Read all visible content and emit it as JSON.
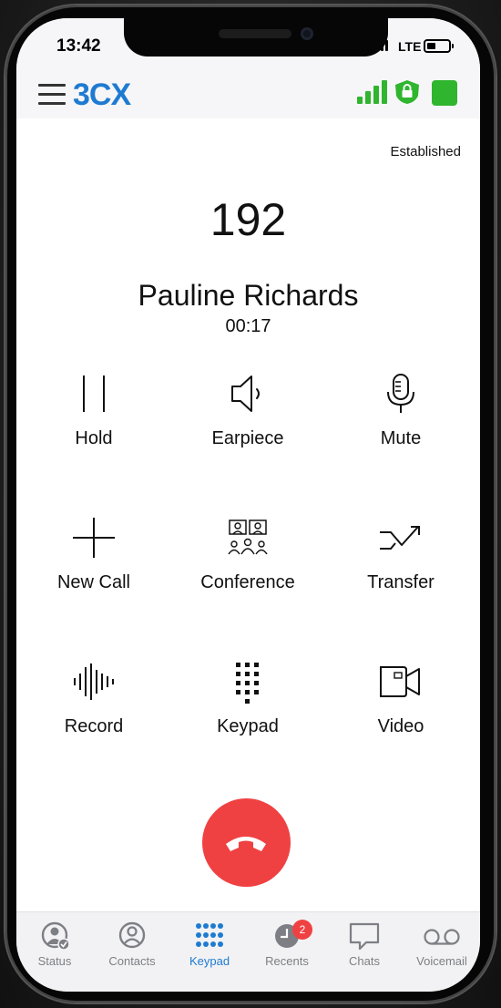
{
  "statusbar": {
    "time": "13:42",
    "network": "LTE",
    "battery_level": 0.4
  },
  "header": {
    "logo": "3CX",
    "signal_color": "#2fb52e",
    "presence_color": "#2fb52e"
  },
  "call": {
    "state": "Established",
    "number": "192",
    "name": "Pauline Richards",
    "duration": "00:17"
  },
  "actions": [
    {
      "label": "Hold",
      "icon": "pause-icon"
    },
    {
      "label": "Earpiece",
      "icon": "speaker-icon"
    },
    {
      "label": "Mute",
      "icon": "microphone-icon"
    },
    {
      "label": "New Call",
      "icon": "plus-icon"
    },
    {
      "label": "Conference",
      "icon": "conference-icon"
    },
    {
      "label": "Transfer",
      "icon": "transfer-icon"
    },
    {
      "label": "Record",
      "icon": "waveform-icon"
    },
    {
      "label": "Keypad",
      "icon": "dialpad-icon"
    },
    {
      "label": "Video",
      "icon": "video-camera-icon"
    }
  ],
  "hangup": {
    "icon": "hangup-phone-icon",
    "color": "#f04142"
  },
  "tabs": [
    {
      "label": "Status",
      "icon": "status-icon",
      "active": false
    },
    {
      "label": "Contacts",
      "icon": "contacts-icon",
      "active": false
    },
    {
      "label": "Keypad",
      "icon": "dialpad-icon",
      "active": true
    },
    {
      "label": "Recents",
      "icon": "clock-icon",
      "active": false,
      "badge": "2"
    },
    {
      "label": "Chats",
      "icon": "chat-bubble-icon",
      "active": false
    },
    {
      "label": "Voicemail",
      "icon": "voicemail-icon",
      "active": false
    }
  ],
  "colors": {
    "accent": "#1e7bd1",
    "danger": "#f04142",
    "ok": "#2fb52e"
  }
}
